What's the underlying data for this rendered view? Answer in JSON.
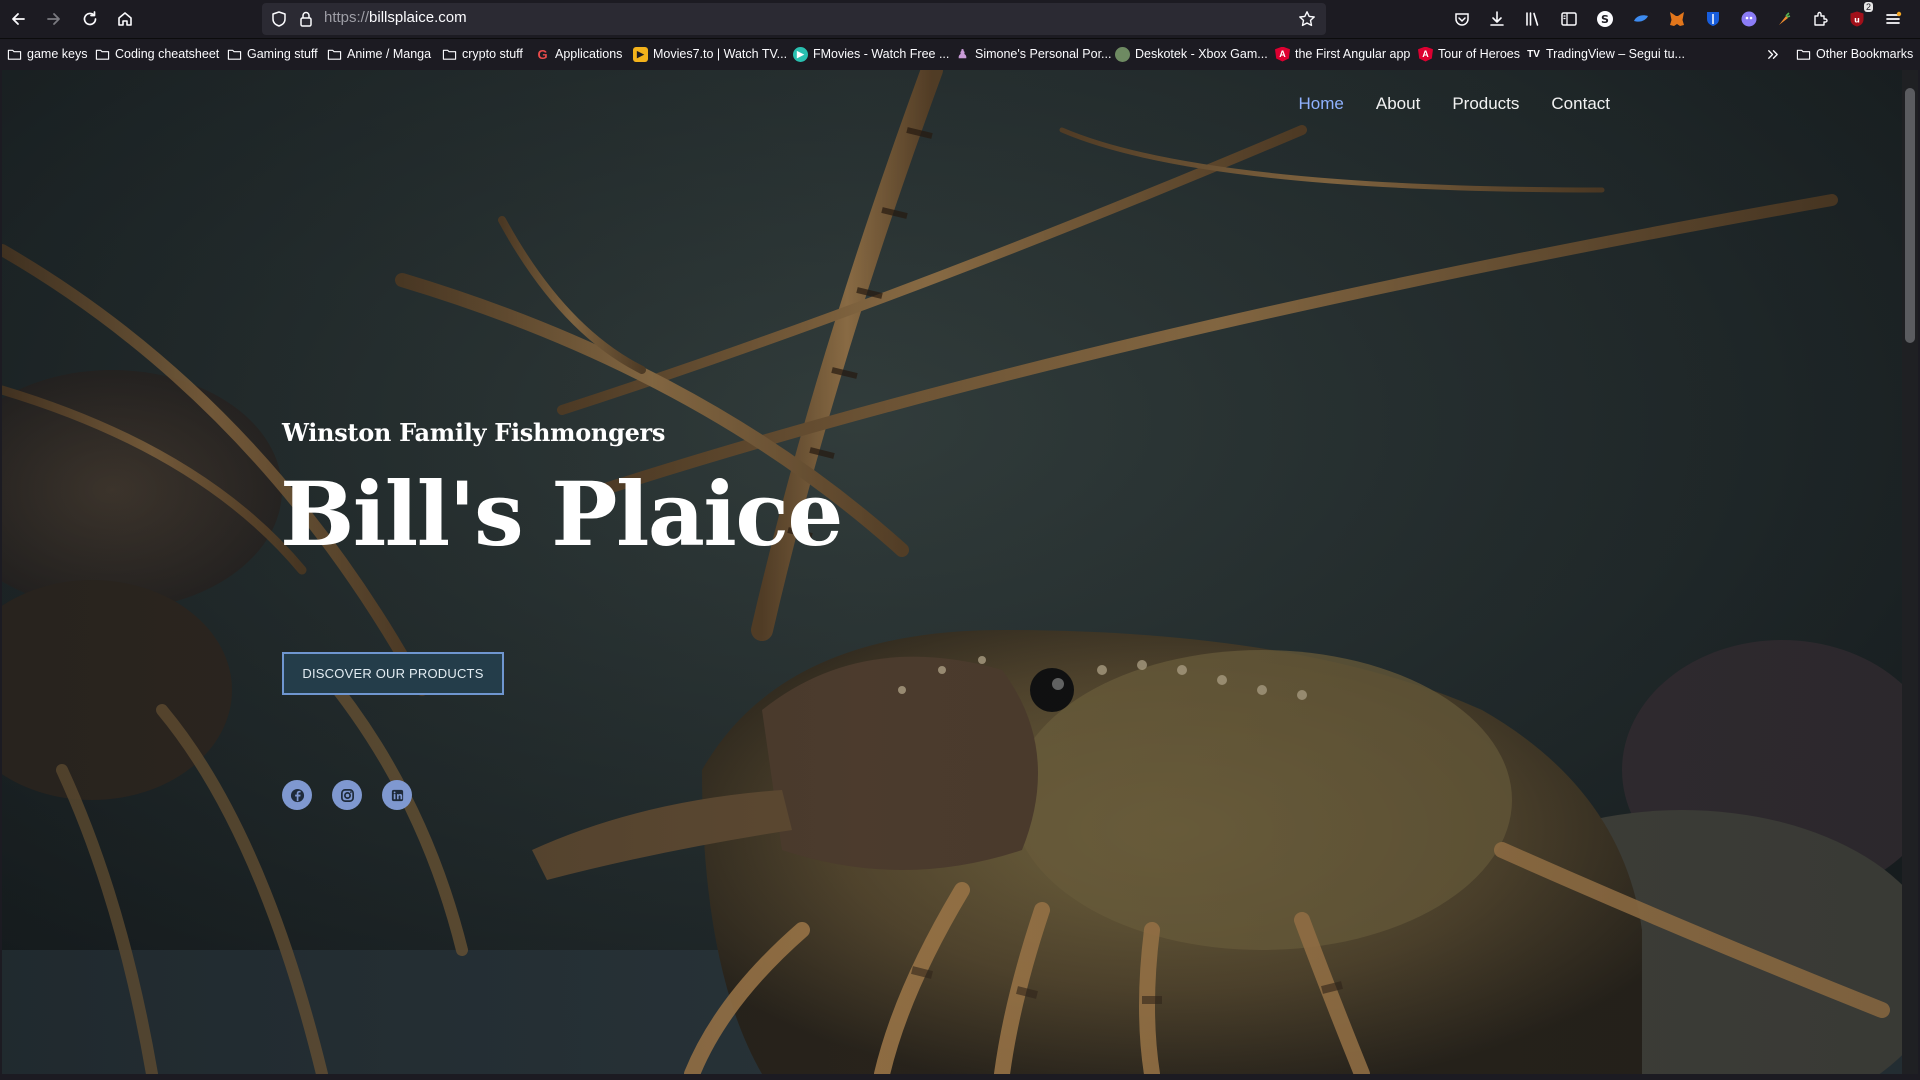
{
  "browser": {
    "url_protocol": "https://",
    "url_host": "billsplaice.com",
    "notification_badge": "2"
  },
  "bookmarks": [
    {
      "label": "game keys",
      "icon": "folder-icon"
    },
    {
      "label": "Coding cheatsheet",
      "icon": "folder-icon"
    },
    {
      "label": "Gaming stuff",
      "icon": "folder-icon"
    },
    {
      "label": "Anime / Manga",
      "icon": "folder-icon"
    },
    {
      "label": "crypto stuff",
      "icon": "folder-icon"
    },
    {
      "label": "Applications",
      "icon": "g-favicon"
    },
    {
      "label": "Movies7.to | Watch TV...",
      "icon": "movies-favicon"
    },
    {
      "label": "FMovies - Watch Free ...",
      "icon": "play-favicon"
    },
    {
      "label": "Simone's Personal Por...",
      "icon": "person-favicon"
    },
    {
      "label": "Deskotek - Xbox Gam...",
      "icon": "globe-favicon"
    },
    {
      "label": "the First Angular app",
      "icon": "angular-favicon"
    },
    {
      "label": "Tour of Heroes",
      "icon": "angular-favicon"
    },
    {
      "label": "TradingView – Segui tu...",
      "icon": "tradingview-favicon"
    }
  ],
  "other_bookmarks": "Other Bookmarks",
  "site": {
    "nav": [
      "Home",
      "About",
      "Products",
      "Contact"
    ],
    "active_nav": "Home",
    "subtitle": "Winston Family Fishmongers",
    "title": "Bill's Plaice",
    "cta": "DISCOVER OUR PRODUCTS",
    "social": [
      "facebook-icon",
      "instagram-icon",
      "linkedin-icon"
    ]
  },
  "colors": {
    "accent": "#8fb1ff",
    "button_bg": "#243d4a",
    "button_border": "#6f96d0",
    "social_bg": "#7f98d0"
  }
}
